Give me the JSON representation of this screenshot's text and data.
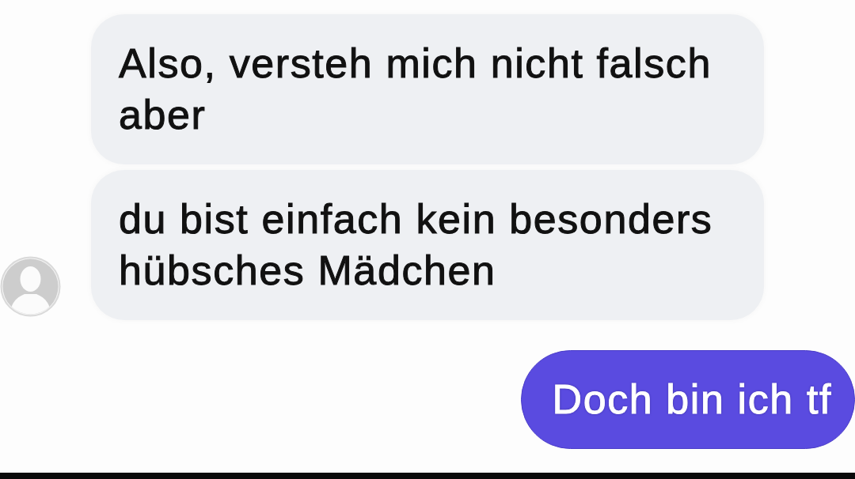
{
  "messages": [
    {
      "kind": "received",
      "text": "Also, versteh mich nicht falsch aber",
      "show_avatar": false
    },
    {
      "kind": "received",
      "text": "du bist einfach kein besonders hübsches Mädchen",
      "show_avatar": true
    },
    {
      "kind": "sent",
      "text": "Doch bin ich tf"
    }
  ]
}
